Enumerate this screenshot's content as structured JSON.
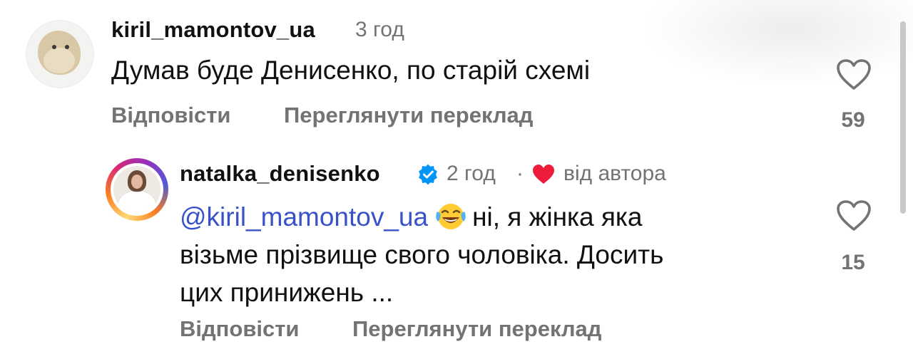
{
  "comments": [
    {
      "username": "kiril_mamontov_ua",
      "time": "3 год",
      "text": "Думав буде Денисенко, по старій схемі",
      "reply_label": "Відповісти",
      "translate_label": "Переглянути переклад",
      "likes": "59"
    },
    {
      "username": "natalka_denisenko",
      "verified": true,
      "time": "2 год",
      "separator": "·",
      "by_author": "від автора",
      "mention": "@kiril_mamontov_ua",
      "emoji": "face-with-tears-of-joy",
      "text_line1": "ні, я жінка яка",
      "text_line2": "візьме прізвище свого чоловіка. Досить",
      "text_line3": "цих принижень ...",
      "reply_label": "Відповісти",
      "translate_label": "Переглянути переклад",
      "likes": "15"
    }
  ],
  "colors": {
    "mention": "#3a52c9",
    "secondary_text": "#737373",
    "verified": "#0095f6",
    "creator_heart": "#ed4956"
  }
}
